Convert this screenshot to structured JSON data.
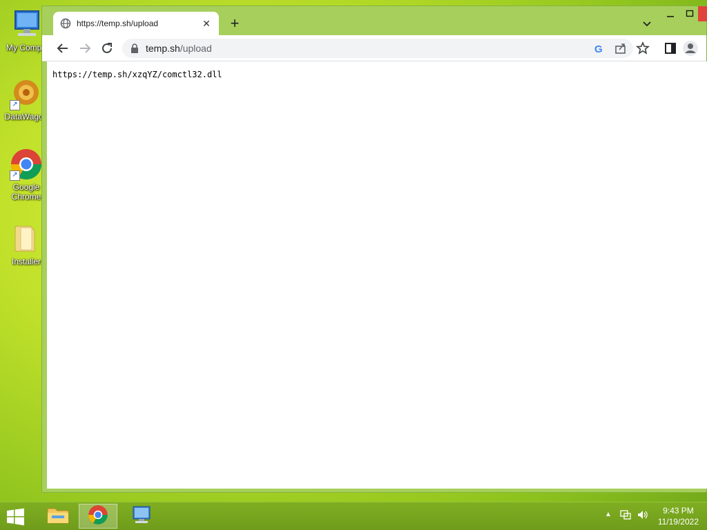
{
  "desktop": {
    "icons": [
      {
        "label": "My Compu"
      },
      {
        "label": "DataWagon"
      },
      {
        "label": "Google Chrome"
      },
      {
        "label": "Installer"
      }
    ]
  },
  "browser": {
    "tab": {
      "title": "https://temp.sh/upload"
    },
    "address": {
      "host": "temp.sh",
      "path": "/upload"
    },
    "page_text": "https://temp.sh/xzqYZ/comctl32.dll"
  },
  "taskbar": {
    "apps": [
      "file-explorer",
      "google-chrome",
      "remote-desktop"
    ],
    "clock": {
      "time": "9:43 PM",
      "date": "11/19/2022"
    }
  },
  "colors": {
    "accent": "#a6cf5c",
    "close": "#e0443a"
  }
}
